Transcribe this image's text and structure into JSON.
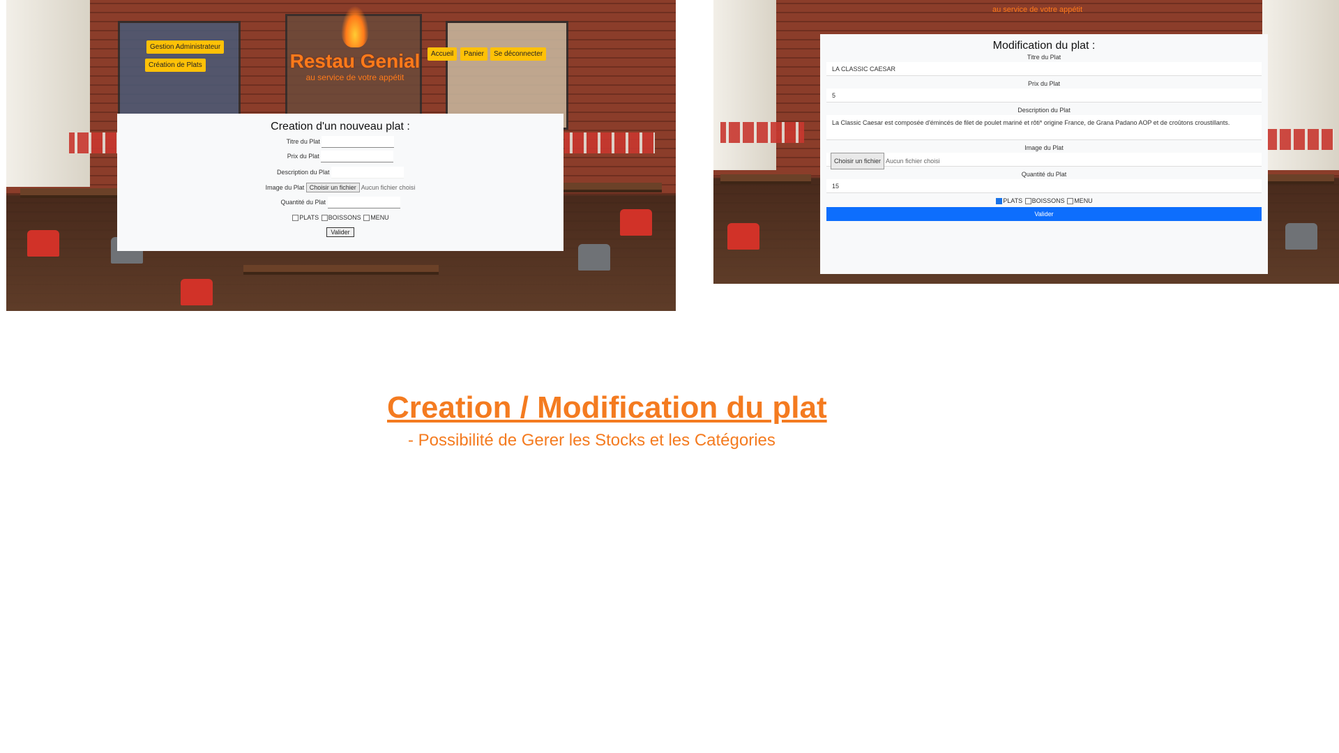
{
  "left_screen": {
    "admin_button": "Gestion Administrateur",
    "create_plates_button": "Création de Plats",
    "brand": "Restau Genial",
    "tagline": "au service de votre appétit",
    "nav": [
      "Accueil",
      "Panier",
      "Se déconnecter"
    ],
    "form": {
      "title": "Creation d'un nouveau plat :",
      "title_label": "Titre du Plat",
      "price_label": "Prix du Plat",
      "description_label": "Description du Plat",
      "image_label": "Image du Plat",
      "file_button": "Choisir un fichier",
      "file_status": "Aucun fichier choisi",
      "quantity_label": "Quantité du Plat",
      "categories": [
        "PLATS",
        "BOISSONS",
        "MENU"
      ],
      "submit": "Valider"
    }
  },
  "right_screen": {
    "tagline": "au service de votre appétit",
    "form": {
      "title": "Modification du plat :",
      "title_label": "Titre du Plat",
      "title_value": "LA CLASSIC CAESAR",
      "price_label": "Prix du Plat",
      "price_value": "5",
      "description_label": "Description du Plat",
      "description_value": "La Classic Caesar est composée d'émincés de filet de poulet mariné et rôti* origine France, de Grana Padano AOP et de croûtons croustillants.",
      "image_label": "Image du Plat",
      "file_button": "Choisir un fichier",
      "file_status": "Aucun fichier choisi",
      "quantity_label": "Quantité du Plat",
      "quantity_value": "15",
      "categories": [
        "PLATS",
        "BOISSONS",
        "MENU"
      ],
      "checked_category": "PLATS",
      "submit": "Valider"
    }
  },
  "caption": {
    "title": "Creation / Modification du plat",
    "subtitle": "- Possibilité de Gerer les Stocks et les Catégories"
  },
  "colors": {
    "accent": "#f47b20",
    "nav_button": "#ffc107",
    "primary_button": "#0d6efd"
  }
}
